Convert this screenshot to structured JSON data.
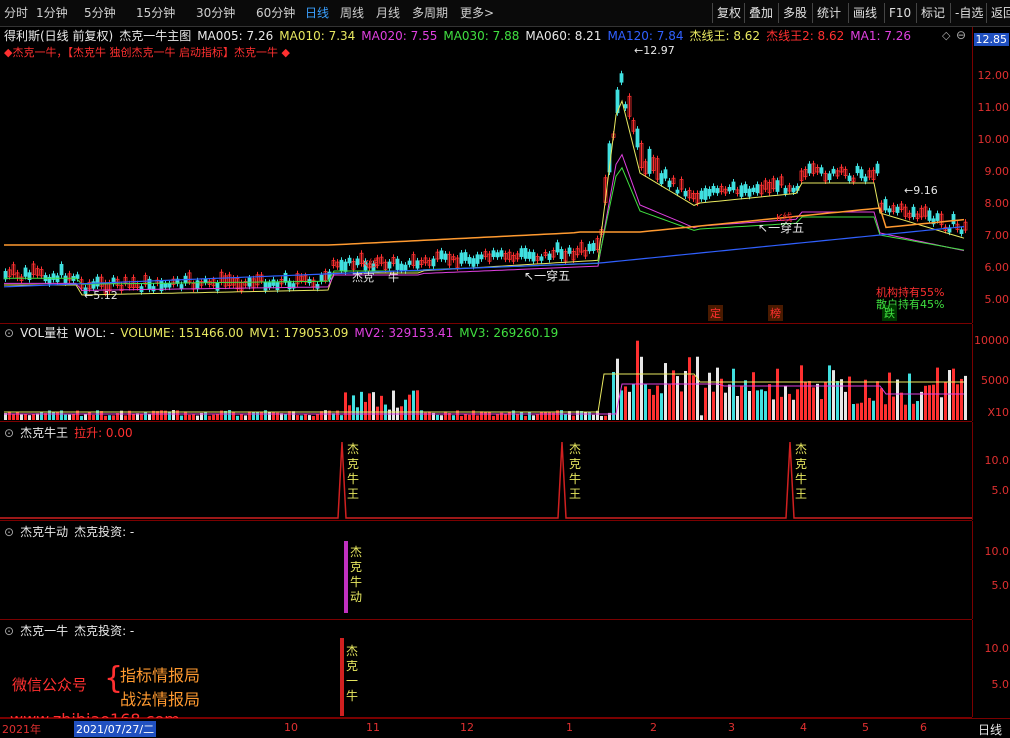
{
  "toolbar": {
    "periods": [
      "分时",
      "1分钟",
      "5分钟",
      "15分钟",
      "30分钟",
      "60分钟",
      "日线",
      "周线",
      "月线",
      "多周期",
      "更多>"
    ],
    "active": "日线",
    "right_buttons": [
      "复权",
      "叠加",
      "多股",
      "统计",
      "画线",
      "F10",
      "标记",
      "-自选",
      "返回"
    ]
  },
  "main": {
    "stock": "得利斯(日线 前复权)",
    "indicator": "杰克一牛主图",
    "ma": [
      {
        "label": "MA005: 7.26",
        "color": "#e8e8e8"
      },
      {
        "label": "MA010: 7.34",
        "color": "#e8e860"
      },
      {
        "label": "MA020: 7.55",
        "color": "#e040e0"
      },
      {
        "label": "MA030: 7.88",
        "color": "#40e040"
      },
      {
        "label": "MA060: 8.21",
        "color": "#e8e8e8"
      },
      {
        "label": "MA120: 7.84",
        "color": "#3060ff"
      },
      {
        "label": "杰线王: 8.62",
        "color": "#e8e860"
      },
      {
        "label": "杰线王2: 8.62",
        "color": "#ff3030"
      },
      {
        "label": "MA1: 7.26",
        "color": "#e040e0"
      }
    ],
    "banner": "◆杰克一牛，【杰克牛 独创杰克一牛 启动指标】杰克一牛 ◆",
    "price_axis": [
      "12.85",
      "12.00",
      "11.00",
      "10.00",
      "9.00",
      "8.00",
      "7.00",
      "6.00",
      "5.00"
    ],
    "annotations": {
      "high": "12.97",
      "low": "5.12",
      "yi_chuan_wu_1": "一穿五",
      "yi_chuan_wu_2": "一穿五",
      "level": "9.16",
      "k1": "K线",
      "k2": "K线",
      "ding": "定",
      "bang": "榜",
      "die": "跌",
      "inst": "机构持有55%",
      "retail": "散户持有45%",
      "jieke": "杰克",
      "niu": "牛"
    }
  },
  "volume": {
    "title": "VOL量柱",
    "wol": "WOL: -",
    "values": [
      {
        "label": "VOLUME: 151466.00",
        "color": "#e8e860"
      },
      {
        "label": "MV1: 179053.09",
        "color": "#e8e860"
      },
      {
        "label": "MV2: 329153.41",
        "color": "#e040e0"
      },
      {
        "label": "MV3: 269260.19",
        "color": "#40e040"
      }
    ],
    "axis": [
      "10000",
      "5000",
      "X10"
    ]
  },
  "niuwang": {
    "title": "杰克牛王",
    "sub": "拉升: 0.00",
    "axis": [
      "10.0",
      "5.0"
    ],
    "marks": [
      "杰",
      "克",
      "牛",
      "王"
    ]
  },
  "niudong": {
    "title": "杰克牛动",
    "sub": "杰克投资: -",
    "axis": [
      "10.0",
      "5.0"
    ],
    "marks": [
      "杰",
      "克",
      "牛",
      "动"
    ]
  },
  "yiniu": {
    "title": "杰克一牛",
    "sub": "杰克投资: -",
    "axis": [
      "10.0",
      "5.0"
    ],
    "marks": [
      "杰",
      "克",
      "一",
      "牛"
    ]
  },
  "dates": {
    "year": "2021年",
    "cursor": "2021/07/27/二",
    "months": [
      "10",
      "11",
      "12",
      "1",
      "2",
      "3",
      "4",
      "5",
      "6"
    ],
    "period_label": "日线"
  },
  "watermark": {
    "wechat": "微信公众号",
    "line1": "指标情报局",
    "line2": "战法情报局",
    "url": "www.zhibiao168.com"
  },
  "colors": {
    "up": "#ff3030",
    "down": "#40e0e0",
    "axis": "#7a0000",
    "ma120": "#3060ff",
    "orange": "#ff9a30"
  }
}
